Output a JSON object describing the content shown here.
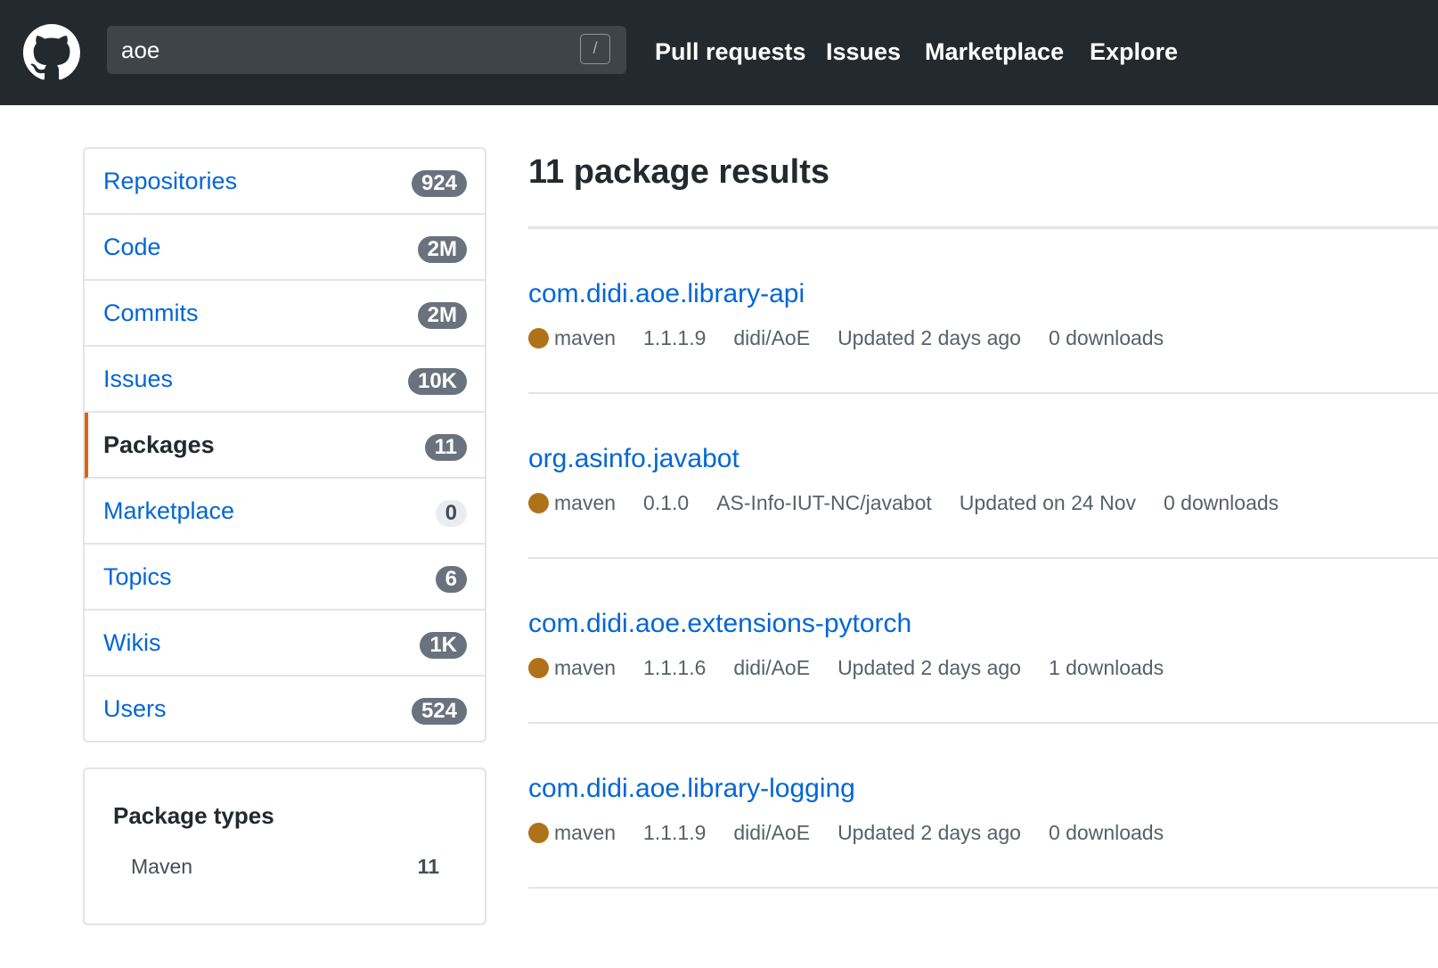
{
  "header": {
    "search_value": "aoe",
    "search_key_hint": "/",
    "nav": [
      "Pull requests",
      "Issues",
      "Marketplace",
      "Explore"
    ]
  },
  "sidebar": {
    "items": [
      {
        "label": "Repositories",
        "count": "924"
      },
      {
        "label": "Code",
        "count": "2M"
      },
      {
        "label": "Commits",
        "count": "2M"
      },
      {
        "label": "Issues",
        "count": "10K"
      },
      {
        "label": "Packages",
        "count": "11",
        "selected": true
      },
      {
        "label": "Marketplace",
        "count": "0"
      },
      {
        "label": "Topics",
        "count": "6"
      },
      {
        "label": "Wikis",
        "count": "1K"
      },
      {
        "label": "Users",
        "count": "524"
      }
    ]
  },
  "package_types": {
    "title": "Package types",
    "items": [
      {
        "label": "Maven",
        "count": "11"
      }
    ]
  },
  "results": {
    "title": "11 package results",
    "items": [
      {
        "name": "com.didi.aoe.library-api",
        "type": "maven",
        "version": "1.1.1.9",
        "repo": "didi/AoE",
        "updated": "Updated 2 days ago",
        "downloads": "0 downloads"
      },
      {
        "name": "org.asinfo.javabot",
        "type": "maven",
        "version": "0.1.0",
        "repo": "AS-Info-IUT-NC/javabot",
        "updated": "Updated on 24 Nov",
        "downloads": "0 downloads"
      },
      {
        "name": "com.didi.aoe.extensions-pytorch",
        "type": "maven",
        "version": "1.1.1.6",
        "repo": "didi/AoE",
        "updated": "Updated 2 days ago",
        "downloads": "1 downloads"
      },
      {
        "name": "com.didi.aoe.library-logging",
        "type": "maven",
        "version": "1.1.1.9",
        "repo": "didi/AoE",
        "updated": "Updated 2 days ago",
        "downloads": "0 downloads"
      }
    ]
  },
  "colors": {
    "header_bg": "#24292e",
    "link": "#0366d6",
    "selected_accent": "#e36209",
    "java_dot": "#b07219"
  },
  "icons": {
    "logo": "github-octocat-icon",
    "language": "language-color-dot"
  }
}
